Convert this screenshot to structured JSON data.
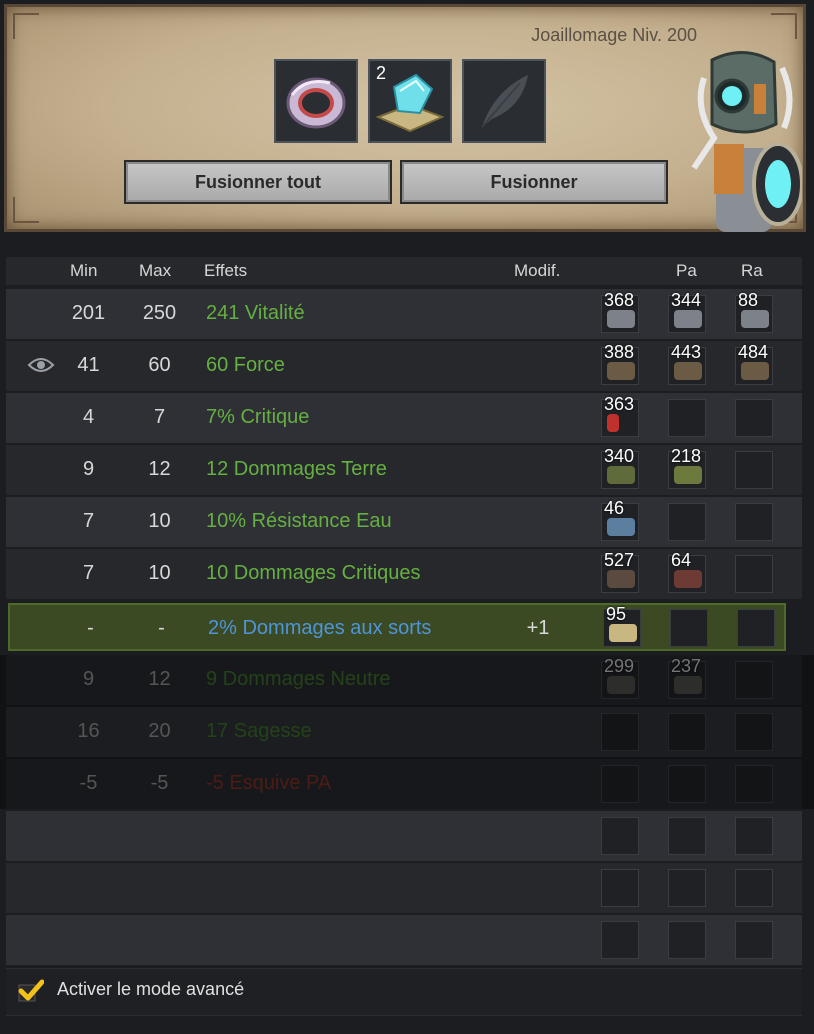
{
  "header": {
    "job_level": "Joaillomage Niv. 200",
    "slots": [
      {
        "name": "ring-item",
        "qty": ""
      },
      {
        "name": "rune-stack",
        "qty": "2"
      },
      {
        "name": "empty-feather-slot",
        "qty": ""
      }
    ],
    "buttons": {
      "fuse_all": "Fusionner tout",
      "fuse": "Fusionner"
    }
  },
  "table": {
    "columns": {
      "min": "Min",
      "max": "Max",
      "effects": "Effets",
      "modif": "Modif.",
      "pa": "Pa",
      "ra": "Ra"
    },
    "rows": [
      {
        "min": "201",
        "max": "250",
        "effect": "241 Vitalité",
        "modif": "",
        "runes": [
          "368",
          "344",
          "88"
        ]
      },
      {
        "min": "41",
        "max": "60",
        "effect": "60 Force",
        "modif": "",
        "runes": [
          "388",
          "443",
          "484"
        ]
      },
      {
        "min": "4",
        "max": "7",
        "effect": "7% Critique",
        "modif": "",
        "runes": [
          "363",
          "",
          ""
        ]
      },
      {
        "min": "9",
        "max": "12",
        "effect": "12 Dommages Terre",
        "modif": "",
        "runes": [
          "340",
          "218",
          ""
        ]
      },
      {
        "min": "7",
        "max": "10",
        "effect": "10% Résistance Eau",
        "modif": "",
        "runes": [
          "46",
          "",
          ""
        ]
      },
      {
        "min": "7",
        "max": "10",
        "effect": "10 Dommages Critiques",
        "modif": "",
        "runes": [
          "527",
          "64",
          ""
        ]
      },
      {
        "min": "-",
        "max": "-",
        "effect": "2% Dommages aux sorts",
        "modif": "+1",
        "runes": [
          "95",
          "",
          ""
        ]
      },
      {
        "min": "9",
        "max": "12",
        "effect": "9 Dommages Neutre",
        "modif": "",
        "runes": [
          "299",
          "237",
          ""
        ]
      },
      {
        "min": "16",
        "max": "20",
        "effect": "17 Sagesse",
        "modif": "",
        "runes": [
          "",
          "",
          ""
        ]
      },
      {
        "min": "-5",
        "max": "-5",
        "effect": "-5 Esquive PA",
        "modif": "",
        "runes": [
          "",
          "",
          ""
        ]
      },
      {
        "min": "",
        "max": "",
        "effect": "",
        "modif": "",
        "runes": [
          "",
          "",
          ""
        ]
      },
      {
        "min": "",
        "max": "",
        "effect": "",
        "modif": "",
        "runes": [
          "",
          "",
          ""
        ]
      },
      {
        "min": "",
        "max": "",
        "effect": "",
        "modif": "",
        "runes": [
          "",
          "",
          ""
        ]
      }
    ]
  },
  "footer": {
    "advanced_mode_label": "Activer le mode avancé",
    "advanced_mode_checked": true
  },
  "colors": {
    "effect_green": "#65b041",
    "effect_blue": "#4e94d8",
    "selected_row": "#3b4a22",
    "checkbox": "#f2c21b"
  }
}
